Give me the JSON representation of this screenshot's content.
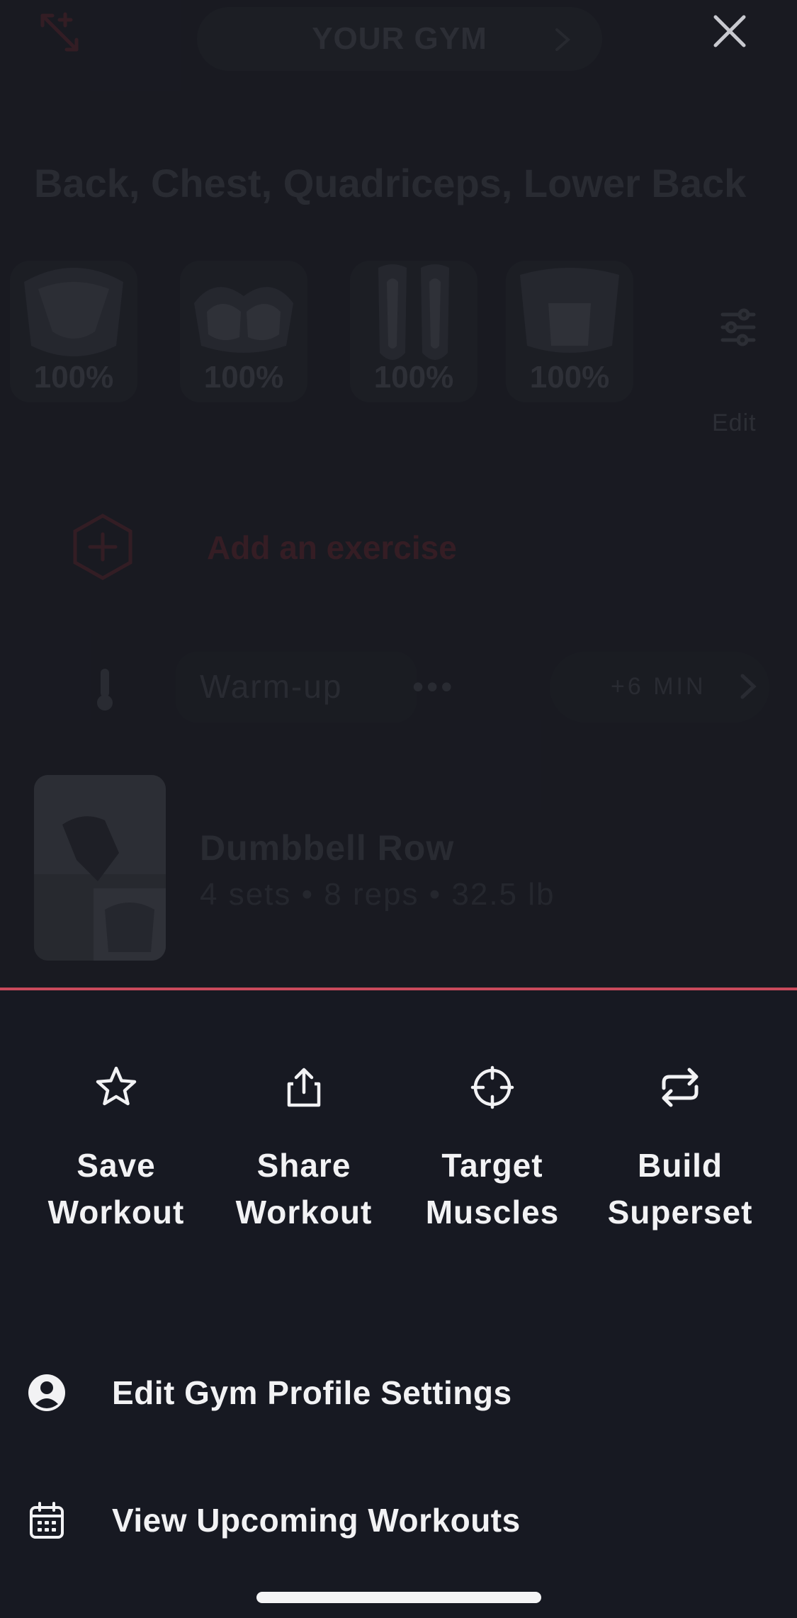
{
  "header": {
    "gym_label": "YOUR GYM"
  },
  "muscles": {
    "title": "Back, Chest, Quadriceps, Lower Back",
    "cards": [
      {
        "name": "back",
        "percent": "100%"
      },
      {
        "name": "chest",
        "percent": "100%"
      },
      {
        "name": "quadriceps",
        "percent": "100%"
      },
      {
        "name": "lower-back",
        "percent": "100%"
      }
    ],
    "edit_label": "Edit"
  },
  "workout": {
    "add_exercise_label": "Add an exercise",
    "warmup_label": "Warm-up",
    "warmup_more": "•••",
    "warmup_time": "+6 MIN",
    "exercises": [
      {
        "name": "Dumbbell Row",
        "meta": "4 sets • 8 reps • 32.5 lb"
      }
    ]
  },
  "sheet": {
    "accent_color": "#c94a5c",
    "actions": [
      {
        "icon": "star-icon",
        "label": "Save\nWorkout"
      },
      {
        "icon": "share-icon",
        "label": "Share\nWorkout"
      },
      {
        "icon": "target-icon",
        "label": "Target\nMuscles"
      },
      {
        "icon": "repeat-icon",
        "label": "Build\nSuperset"
      }
    ],
    "menu": [
      {
        "icon": "user-circle-icon",
        "label": "Edit Gym Profile Settings"
      },
      {
        "icon": "calendar-icon",
        "label": "View Upcoming Workouts"
      }
    ]
  }
}
